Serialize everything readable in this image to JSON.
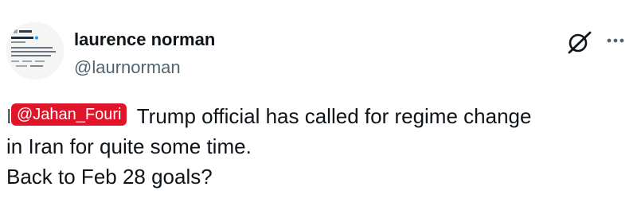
{
  "author": {
    "display_name": "laurence norman",
    "handle": "@laurnorman"
  },
  "icons": {
    "avatar": "profile-avatar",
    "grok": "grok-icon",
    "more": "more-options-icon"
  },
  "tweet": {
    "line1_covered": "It",
    "line1_rest": " Trump official has called for regime change",
    "line2": "in Iran for quite some time.",
    "line3": "Back to Feb 28 goals?"
  },
  "watermark": {
    "text": "@Jahan_Fouri",
    "color": "#e0152a"
  }
}
